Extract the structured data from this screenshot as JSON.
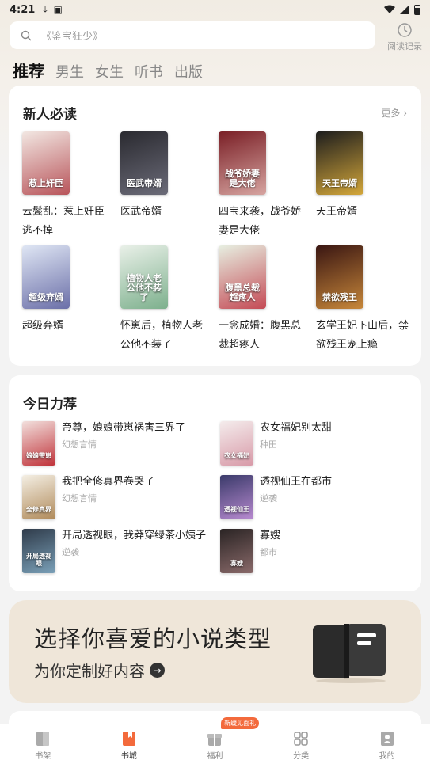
{
  "status": {
    "time": "4:21"
  },
  "search": {
    "placeholder": "《鉴宝狂少》"
  },
  "history": {
    "label": "阅读记录"
  },
  "tabs": [
    "推荐",
    "男生",
    "女生",
    "听书",
    "出版"
  ],
  "section1": {
    "title": "新人必读",
    "more": "更多",
    "books": [
      {
        "title": "云鬓乱：惹上奸臣逃不掉",
        "cover_text": "惹上奸臣",
        "color1": "#f2e7e2",
        "color2": "#b8545a"
      },
      {
        "title": "医武帝婿",
        "cover_text": "医武帝婿",
        "color1": "#2a2a30",
        "color2": "#6b6b78"
      },
      {
        "title": "四宝来袭，战爷娇妻是大佬",
        "cover_text": "战爷娇妻是大佬",
        "color1": "#7a1f26",
        "color2": "#d6a4a0"
      },
      {
        "title": "天王帝婿",
        "cover_text": "天王帝婿",
        "color1": "#1d1d1d",
        "color2": "#d4a73a"
      },
      {
        "title": "超级弃婿",
        "cover_text": "超级弃婿",
        "color1": "#dfe6f4",
        "color2": "#6b6fa8"
      },
      {
        "title": "怀崽后，植物人老公他不装了",
        "cover_text": "植物人老公他不装了",
        "color1": "#e9f0e8",
        "color2": "#7db08d"
      },
      {
        "title": "一念成婚：腹黑总裁超疼人",
        "cover_text": "腹黑总裁超疼人",
        "color1": "#e7efe1",
        "color2": "#c44a55"
      },
      {
        "title": "玄学王妃下山后，禁欲残王宠上瘾",
        "cover_text": "禁欲残王",
        "color1": "#3a1612",
        "color2": "#c7873a"
      }
    ]
  },
  "section2": {
    "title": "今日力荐",
    "items": [
      {
        "title": "帝尊，娘娘带崽祸害三界了",
        "category": "幻想言情",
        "cover_text": "娘娘带崽",
        "color1": "#f2e0dd",
        "color2": "#c0333a"
      },
      {
        "title": "农女福妃别太甜",
        "category": "种田",
        "cover_text": "农女福妃",
        "color1": "#f4ecec",
        "color2": "#d89aa8"
      },
      {
        "title": "我把全修真界卷哭了",
        "category": "幻想言情",
        "cover_text": "全修真界",
        "color1": "#f4efe4",
        "color2": "#b08a5a"
      },
      {
        "title": "透视仙王在都市",
        "category": "逆袭",
        "cover_text": "透视仙王",
        "color1": "#3a3a6a",
        "color2": "#b88ad0"
      },
      {
        "title": "开局透视眼，我莽穿绿茶小姨子",
        "category": "逆袭",
        "cover_text": "开局透视眼",
        "color1": "#2f3b4a",
        "color2": "#7aa0b8"
      },
      {
        "title": "寡嫂",
        "category": "都市",
        "cover_text": "寡嫂",
        "color1": "#2a2424",
        "color2": "#8a6a6a"
      }
    ]
  },
  "banner": {
    "title": "选择你喜爱的小说类型",
    "subtitle": "为你定制好内容"
  },
  "nav": {
    "items": [
      {
        "label": "书架",
        "icon": "bookshelf-icon"
      },
      {
        "label": "书城",
        "icon": "bookstore-icon"
      },
      {
        "label": "福利",
        "icon": "gift-icon"
      },
      {
        "label": "分类",
        "icon": "category-icon"
      },
      {
        "label": "我的",
        "icon": "profile-icon"
      }
    ],
    "badge": "新缓见面礼",
    "accent": "#f36a3c"
  }
}
